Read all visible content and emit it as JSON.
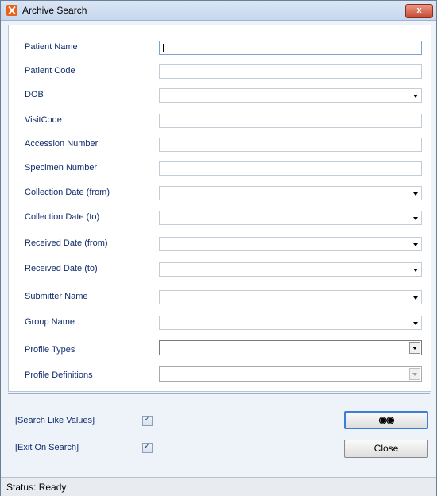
{
  "window": {
    "title": "Archive Search",
    "close_glyph": "x"
  },
  "fields": [
    {
      "label": "Patient Name",
      "type": "text",
      "value": "",
      "focused": true
    },
    {
      "label": "Patient Code",
      "type": "text",
      "value": ""
    },
    {
      "label": "DOB",
      "type": "date",
      "value": ""
    },
    {
      "label": "VisitCode",
      "type": "text",
      "value": ""
    },
    {
      "label": "Accession Number",
      "type": "text",
      "value": ""
    },
    {
      "label": "Specimen Number",
      "type": "text",
      "value": ""
    },
    {
      "label": "Collection Date (from)",
      "type": "date",
      "value": ""
    },
    {
      "label": "Collection Date (to)",
      "type": "date",
      "value": ""
    },
    {
      "label": "Received Date (from)",
      "type": "date",
      "value": ""
    },
    {
      "label": "Received Date (to)",
      "type": "date",
      "value": ""
    },
    {
      "label": "Submitter Name",
      "type": "dropdown",
      "value": ""
    },
    {
      "label": "Group Name",
      "type": "dropdown",
      "value": ""
    },
    {
      "label": "Profile Types",
      "type": "combo",
      "value": ""
    },
    {
      "label": "Profile Definitions",
      "type": "combo",
      "value": "",
      "disabled": true
    }
  ],
  "options": {
    "search_like": {
      "label": "[Search Like Values]",
      "checked": true
    },
    "exit_on_search": {
      "label": "[Exit On Search]",
      "checked": true
    }
  },
  "buttons": {
    "search_icon": "binoculars-icon",
    "close_label": "Close"
  },
  "status": {
    "text": "Status: Ready"
  }
}
